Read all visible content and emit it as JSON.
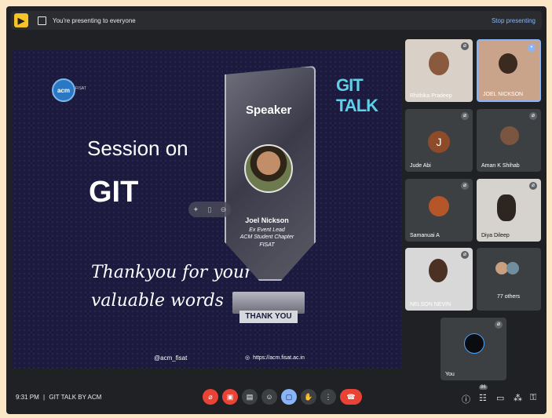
{
  "banner": {
    "text": "You're presenting to everyone",
    "stop_label": "Stop presenting"
  },
  "slide": {
    "logo_text": "acm",
    "logo_sub": "FISAT",
    "brand": "GIT TALK",
    "session_line": "Session on",
    "topic": "GIT",
    "thanks_line1": "Thankyou for your",
    "thanks_line2": "valuable words",
    "speaker_title": "Speaker",
    "speaker_name": "Joel Nickson",
    "speaker_role1": "Ex Event Lead",
    "speaker_role2": "ACM Student Chapter",
    "speaker_role3": "FISAT",
    "thank_you_plaque": "THANK YOU",
    "handle": "@acm_fisat",
    "url": "https://acm.fisat.ac.in"
  },
  "participants": [
    {
      "name": "Rhithika Pradeep"
    },
    {
      "name": "JOEL NICKSON"
    },
    {
      "name": "Jude Abi",
      "initial": "J"
    },
    {
      "name": "Aman K Shihab"
    },
    {
      "name": "Samanuai A"
    },
    {
      "name": "Diya Dileep"
    },
    {
      "name": "NELSON NEVIN"
    },
    {
      "name": "77 others"
    },
    {
      "name": "You"
    }
  ],
  "bottom": {
    "time": "9:31 PM",
    "separator": "|",
    "meeting": "GIT TALK BY ACM",
    "people_badge": "86"
  },
  "colors": {
    "accent": "#8ab4f8",
    "danger": "#ea4335",
    "active": "#8ab4f8"
  }
}
